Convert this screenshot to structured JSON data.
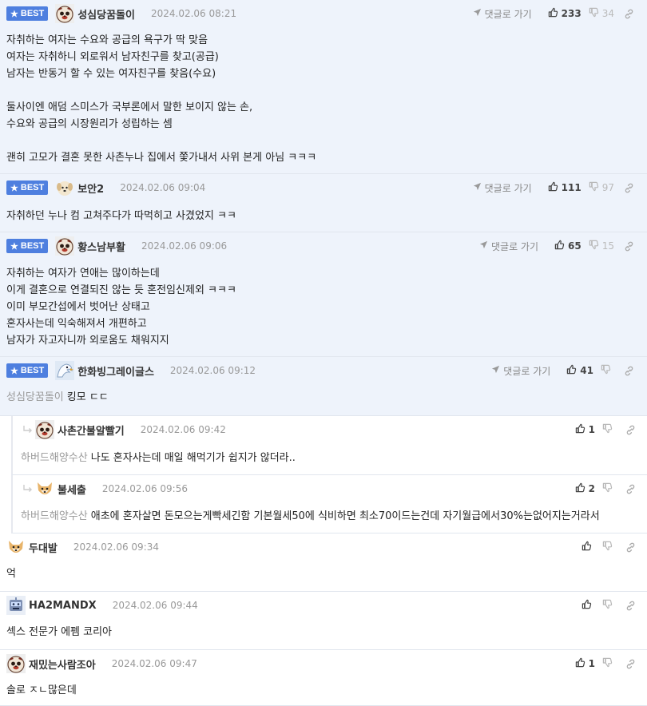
{
  "ui": {
    "best_badge": "BEST",
    "goto_label": "댓글로 가기"
  },
  "comments": [
    {
      "id": "c1",
      "best": true,
      "nick": "성심당꿈돌이",
      "date": "2024.02.06 08:21",
      "up": "233",
      "down": "34",
      "avatar": "dog-mask-avatar",
      "lines": [
        "자취하는 여자는 수요와 공급의 욕구가 딱 맞음",
        "여자는 자취하니 외로워서 남자친구를 찾고(공급)",
        "남자는 반동거 할 수 있는 여자친구를 찾음(수요)",
        "",
        "둘사이엔 애덤 스미스가 국부론에서 말한 보이지 않는 손,",
        "수요와 공급의 시장원리가 성립하는 셈",
        "",
        "괜히 고모가 결혼 못한 사촌누나 집에서 쫓가내서 사위 본게 아님 ㅋㅋㅋ"
      ]
    },
    {
      "id": "c2",
      "best": true,
      "nick": "보안2",
      "date": "2024.02.06 09:04",
      "up": "111",
      "down": "97",
      "avatar": "puppy-avatar",
      "lines": [
        "자취하던 누나 컴 고쳐주다가 따먹히고 사겼었지 ㅋㅋ"
      ]
    },
    {
      "id": "c3",
      "best": true,
      "nick": "황스남부활",
      "date": "2024.02.06 09:06",
      "up": "65",
      "down": "15",
      "avatar": "dog-mask-avatar",
      "lines": [
        "자취하는 여자가 연애는 많이하는데",
        "이게 결혼으로 연결되진 않는 듯 혼전임신제외 ㅋㅋㅋ",
        "이미 부모간섭에서 벗어난 상태고",
        "혼자사는데 익숙해져서 개편하고",
        "남자가 자고자니까 외로움도 채워지지"
      ]
    },
    {
      "id": "c4",
      "best": true,
      "nick": "한화빙그레이글스",
      "date": "2024.02.06 09:12",
      "up": "41",
      "down": "",
      "avatar": "eagle-avatar",
      "mention": "성심당꿈돌이",
      "lines": [
        "킹모 ㄷㄷ"
      ]
    },
    {
      "id": "c5",
      "reply": true,
      "nick": "사촌간불알빨기",
      "date": "2024.02.06 09:42",
      "up": "1",
      "down": "",
      "avatar": "dog-mask-avatar",
      "mention": "하버드해양수산",
      "lines": [
        "나도 혼자사는데 매일 해먹기가 쉽지가 않더라.."
      ]
    },
    {
      "id": "c6",
      "reply": true,
      "nick": "불세출",
      "date": "2024.02.06 09:56",
      "up": "2",
      "down": "",
      "avatar": "shiba-avatar",
      "mention": "하버드해양수산",
      "lines": [
        "애초에 혼자살면 돈모으는게빡세긴함 기본월세50에 식비하면 최소70이드는건데 자기월급에서30%는없어지는거라서"
      ]
    },
    {
      "id": "c7",
      "nick": "두대발",
      "date": "2024.02.06 09:34",
      "up": "",
      "down": "",
      "avatar": "shiba-avatar",
      "lines": [
        "억"
      ]
    },
    {
      "id": "c8",
      "nick": "HA2MANDX",
      "date": "2024.02.06 09:44",
      "up": "",
      "down": "",
      "avatar": "robot-avatar",
      "lines": [
        "섹스 전문가 에펨 코리아"
      ]
    },
    {
      "id": "c9",
      "nick": "재밌는사람조아",
      "date": "2024.02.06 09:47",
      "up": "1",
      "down": "",
      "avatar": "dog-mask-avatar",
      "lines": [
        "솔로 ㅈㄴ많은데"
      ]
    }
  ]
}
